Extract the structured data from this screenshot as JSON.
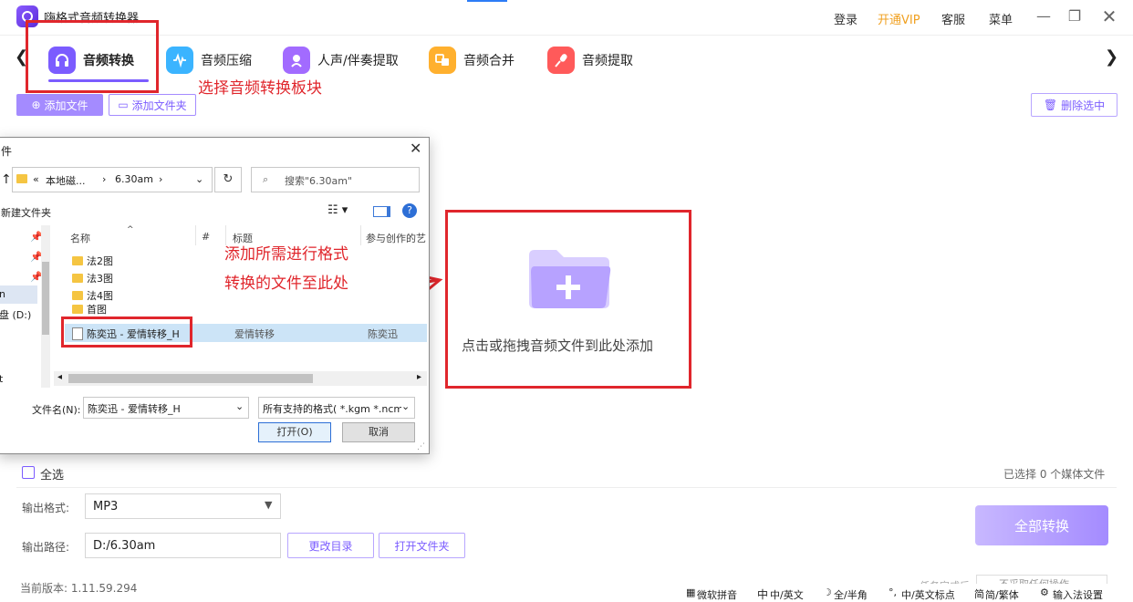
{
  "app": {
    "title": "嗨格式音频转换器",
    "top_links": [
      "登录",
      "开通VIP",
      "客服",
      "菜单"
    ],
    "vip_color": "#f0a020"
  },
  "tabs": [
    {
      "label": "音频转换",
      "icon": "headphones-icon",
      "color": "#7b5cff",
      "selected": true
    },
    {
      "label": "音频压缩",
      "icon": "waveform-icon",
      "color": "#3bb4ff"
    },
    {
      "label": "人声/伴奏提取",
      "icon": "voice-icon",
      "color": "#a26bff"
    },
    {
      "label": "音频合并",
      "icon": "merge-icon",
      "color": "#ffb02e"
    },
    {
      "label": "音频提取",
      "icon": "microphone-icon",
      "color": "#ff5a5a"
    }
  ],
  "annotations": {
    "select_tab": "选择音频转换板块",
    "add_files_line1": "添加所需进行格式",
    "add_files_line2": "转换的文件至此处"
  },
  "toolbar": {
    "add_file": "添加文件",
    "add_folder": "添加文件夹",
    "delete_selected": "删除选中"
  },
  "dialog": {
    "title_partial": "件",
    "breadcrumb_prefix": "«",
    "breadcrumb": [
      "本地磁...",
      "6.30am"
    ],
    "search_placeholder": "搜索\"6.30am\"",
    "new_folder": "新建文件夹",
    "columns": [
      "名称",
      "#",
      "标题",
      "参与创作的艺"
    ],
    "nav_items": [
      "n",
      "盘 (D:)",
      "t"
    ],
    "files": [
      {
        "name": "法2图",
        "type": "folder"
      },
      {
        "name": "法3图",
        "type": "folder"
      },
      {
        "name": "法4图",
        "type": "folder"
      },
      {
        "name": "首图",
        "type": "folder"
      },
      {
        "name": "陈奕迅 - 爱情转移_H",
        "type": "audio",
        "title": "爱情转移",
        "artist": "陈奕迅",
        "selected": true
      }
    ],
    "filename_label": "文件名(N):",
    "filename_value": "陈奕迅 - 爱情转移_H",
    "filter_value": "所有支持的格式( *.kgm *.ncm",
    "open_button": "打开(O)",
    "cancel_button": "取消"
  },
  "dropzone": {
    "text": "点击或拖拽音频文件到此处添加"
  },
  "bottom": {
    "select_all": "全选",
    "selected_count": "已选择 0 个媒体文件",
    "format_label": "输出格式:",
    "format_value": "MP3",
    "path_label": "输出路径:",
    "path_value": "D:/6.30am",
    "change_dir": "更改目录",
    "open_folder": "打开文件夹",
    "convert_all": "全部转换",
    "version": "当前版本: 1.11.59.294",
    "after_task_partial": "任务完成后",
    "no_action_partial": "不采取任何操作"
  },
  "ime_bar": [
    "微软拼音",
    "中/英文",
    "全/半角",
    "中/英文标点",
    "简/繁体",
    "输入法设置"
  ]
}
